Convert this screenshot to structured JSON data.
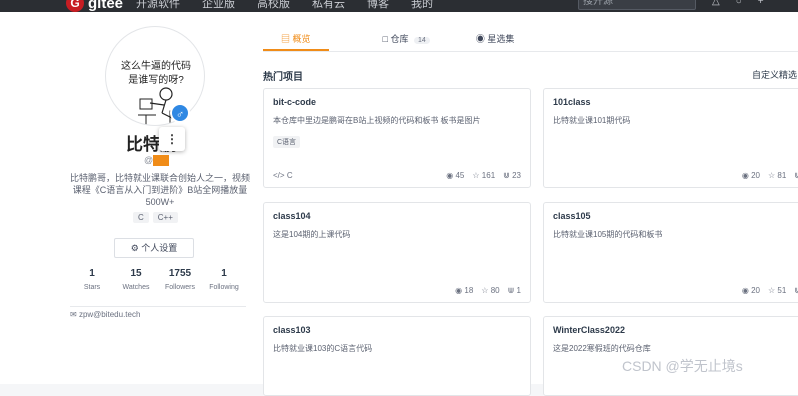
{
  "topbar": {
    "logo_mark": "G",
    "logo_text": "gitee",
    "nav": [
      "开源软件",
      "企业版",
      "高校版",
      "私有云",
      "博客",
      "我的"
    ],
    "search_placeholder": "搜开源",
    "icons": [
      "bell-icon",
      "compass-icon",
      "plus-icon"
    ]
  },
  "profile": {
    "avatar_caption1": "这么牛逼的代码",
    "avatar_caption2": "是谁写的呀?",
    "gender_symbol": "♂",
    "name": "比特鹏",
    "menu_glyph": "⋮",
    "handle": "@",
    "bio": "比特鹏哥，比特就业课联合创始人之一，视频课程《C语言从入门到进阶》B站全网播放量500W+",
    "languages": [
      "C",
      "C++"
    ],
    "settings_label": "个人设置",
    "stats": [
      {
        "num": "1",
        "label": "Stars"
      },
      {
        "num": "15",
        "label": "Watches"
      },
      {
        "num": "1755",
        "label": "Followers"
      },
      {
        "num": "1",
        "label": "Following"
      }
    ],
    "email": "zpw@bitedu.tech"
  },
  "tabs": [
    {
      "label": "概览",
      "count": ""
    },
    {
      "label": "仓库",
      "count": "14"
    },
    {
      "label": "星选集",
      "count": ""
    }
  ],
  "section_title": "热门项目",
  "custom_link": "自定义精选",
  "cards": [
    {
      "title": "bit-c-code",
      "desc": "本仓库中里边是鹏哥在B站上视频的代码和板书 板书是图片",
      "tag": "C语言",
      "lang": "C",
      "watch": "45",
      "star": "161",
      "fork": "23"
    },
    {
      "title": "101class",
      "desc": "比特就业课101期代码",
      "tag": "",
      "lang": "",
      "watch": "20",
      "star": "81",
      "fork": ""
    },
    {
      "title": "class104",
      "desc": "这是104期的上课代码",
      "tag": "",
      "lang": "",
      "watch": "18",
      "star": "80",
      "fork": "1"
    },
    {
      "title": "class105",
      "desc": "比特就业课105期的代码和板书",
      "tag": "",
      "lang": "",
      "watch": "20",
      "star": "51",
      "fork": ""
    },
    {
      "title": "class103",
      "desc": "比特就业课103的C语言代码",
      "tag": "",
      "lang": "",
      "watch": "",
      "star": "",
      "fork": ""
    },
    {
      "title": "WinterClass2022",
      "desc": "这是2022寒假班的代码仓库",
      "tag": "",
      "lang": "",
      "watch": "",
      "star": "",
      "fork": ""
    }
  ],
  "watermark": "CSDN @学无止境s"
}
